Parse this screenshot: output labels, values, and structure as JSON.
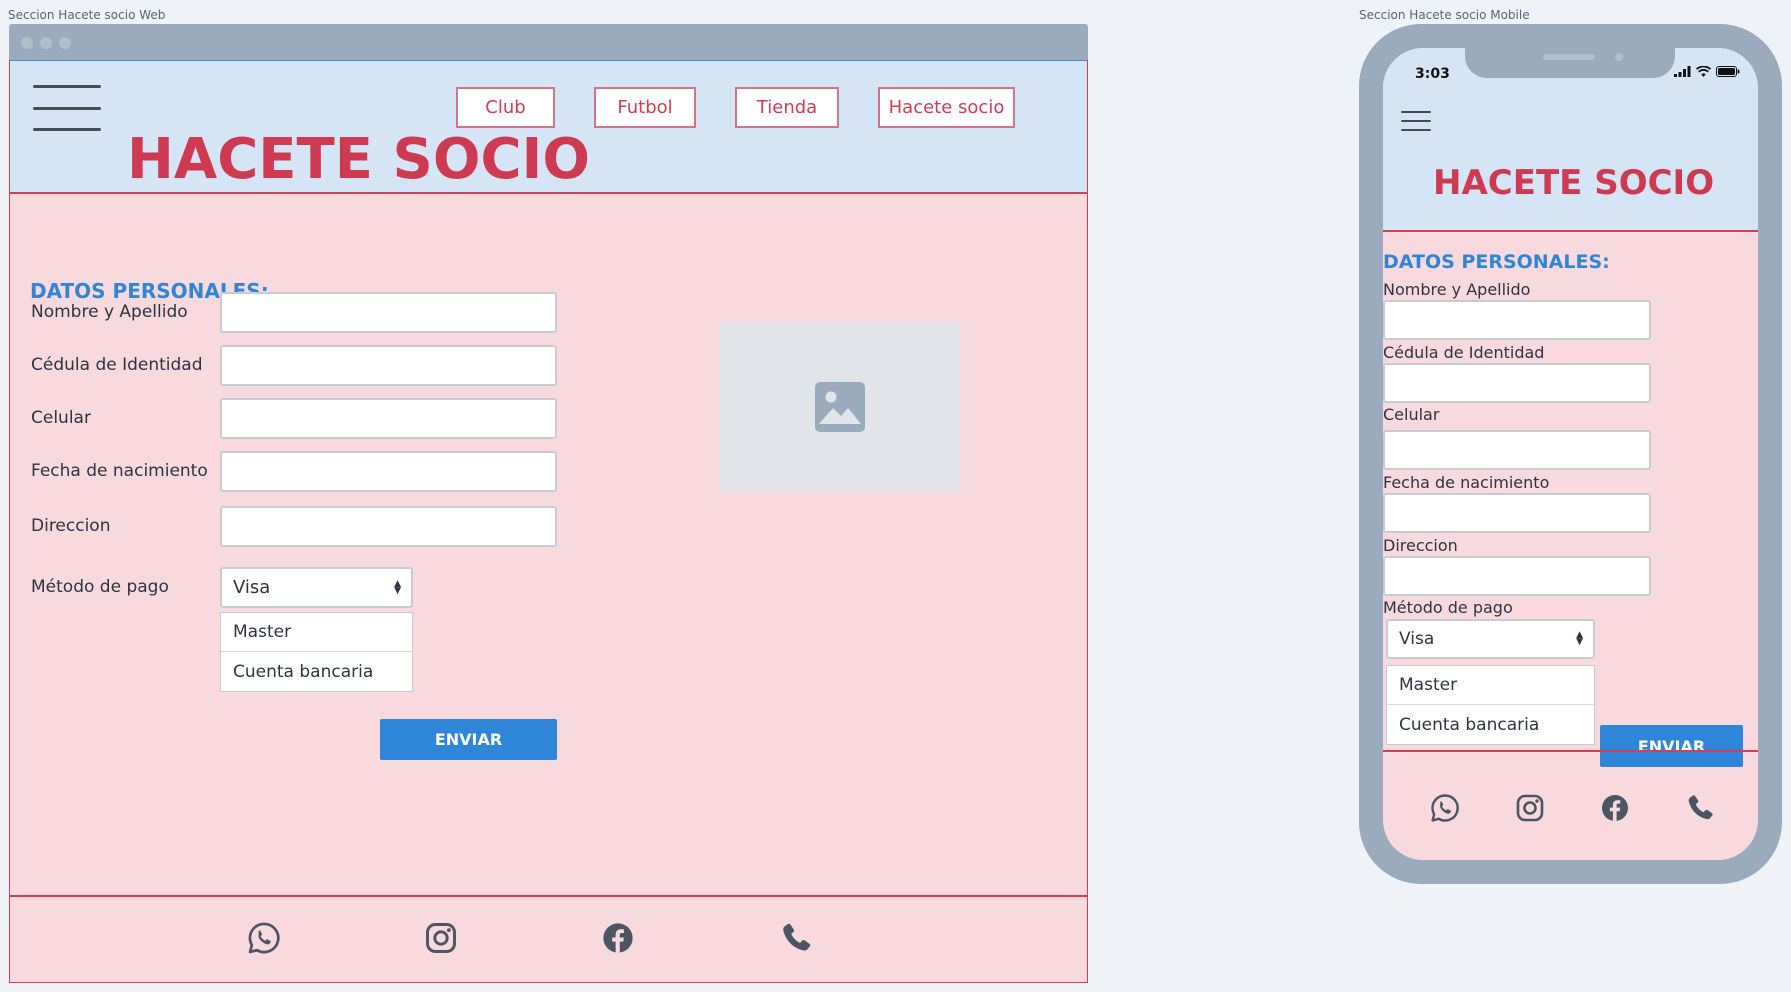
{
  "web": {
    "frame_label": "Seccion Hacete socio Web",
    "nav": [
      "Club",
      "Futbol",
      "Tienda",
      "Hacete socio"
    ],
    "title": "HACETE SOCIO",
    "section_title": "DATOS PERSONALES:",
    "fields": [
      "Nombre y Apellido",
      "Cédula de Identidad",
      "Celular",
      "Fecha de nacimiento",
      "Direccion"
    ],
    "payment_label": "Método de pago",
    "payment_selected": "Visa",
    "payment_options": [
      "Master",
      "Cuenta bancaria"
    ],
    "submit": "ENVIAR",
    "image_placeholder_icon": "image-icon",
    "social_icons": [
      "whatsapp-icon",
      "instagram-icon",
      "facebook-icon",
      "phone-icon"
    ]
  },
  "mobile": {
    "frame_label": "Seccion Hacete socio Mobile",
    "time": "3:03",
    "title": "HACETE SOCIO",
    "section_title": "DATOS PERSONALES:",
    "fields": [
      "Nombre y Apellido",
      "Cédula de Identidad",
      "Celular",
      "Fecha de nacimiento",
      "Direccion"
    ],
    "payment_label": "Método de pago",
    "payment_selected": "Visa",
    "payment_options": [
      "Master",
      "Cuenta bancaria"
    ],
    "submit": "ENVIAR",
    "social_icons": [
      "whatsapp-icon",
      "instagram-icon",
      "facebook-icon",
      "phone-icon"
    ]
  },
  "colors": {
    "brand_red": "#cd3a51",
    "header_blue": "#d5e5f6",
    "accent_blue": "#2f86d9",
    "body_pink": "#f7d9de",
    "device_gray": "#9aabbd"
  }
}
